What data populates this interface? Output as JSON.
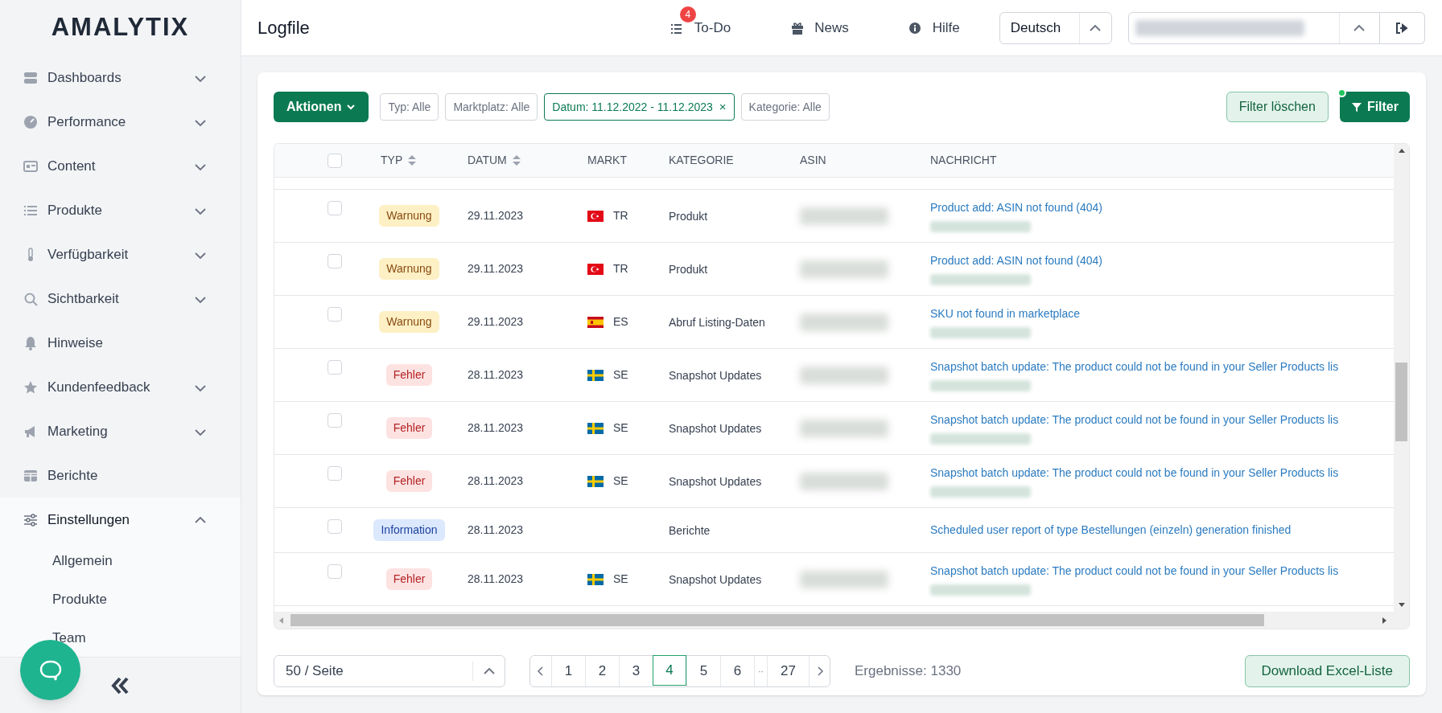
{
  "sidebar": {
    "logo": "AMALYTIX",
    "items": [
      {
        "label": "Dashboards",
        "expanded": false
      },
      {
        "label": "Performance",
        "expanded": false
      },
      {
        "label": "Content",
        "expanded": false
      },
      {
        "label": "Produkte",
        "expanded": false
      },
      {
        "label": "Verfügbarkeit",
        "expanded": false
      },
      {
        "label": "Sichtbarkeit",
        "expanded": false
      },
      {
        "label": "Hinweise"
      },
      {
        "label": "Kundenfeedback",
        "expanded": false
      },
      {
        "label": "Marketing",
        "expanded": false
      },
      {
        "label": "Berichte"
      },
      {
        "label": "Einstellungen",
        "expanded": true,
        "children": [
          {
            "label": "Allgemein"
          },
          {
            "label": "Produkte"
          },
          {
            "label": "Team"
          }
        ]
      }
    ]
  },
  "header": {
    "title": "Logfile",
    "nav": [
      {
        "label": "To-Do",
        "badge": "4"
      },
      {
        "label": "News"
      },
      {
        "label": "Hilfe"
      }
    ],
    "language": "Deutsch"
  },
  "filters": {
    "actions_button": "Aktionen",
    "chips": [
      {
        "label": "Typ: Alle",
        "active": false
      },
      {
        "label": "Marktplatz: Alle",
        "active": false
      },
      {
        "label": "Datum: 11.12.2022 - 11.12.2023",
        "active": true,
        "remove": "×"
      },
      {
        "label": "Kategorie: Alle",
        "active": false
      }
    ],
    "clear_button": "Filter löschen",
    "filter_button": {
      "label": "Filter",
      "active": true
    }
  },
  "table": {
    "header_checked": false,
    "columns": [
      {
        "label": "TYP",
        "sortable": true
      },
      {
        "label": "DATUM",
        "sortable": true
      },
      {
        "label": "MARKT",
        "sortable": false
      },
      {
        "label": "KATEGORIE",
        "sortable": false
      },
      {
        "label": "ASIN",
        "sortable": false
      },
      {
        "label": "NACHRICHT",
        "sortable": false
      }
    ],
    "rows": [
      {
        "checked": false,
        "type": {
          "label": "Warnung",
          "kind": "warning"
        },
        "date": "29.11.2023",
        "market": {
          "kind": "tr",
          "code": "TR"
        },
        "category": "Produkt",
        "asin_redacted": true,
        "message": "Product add: ASIN not found (404)",
        "detail_redacted": true
      },
      {
        "checked": false,
        "type": {
          "label": "Warnung",
          "kind": "warning"
        },
        "date": "29.11.2023",
        "market": {
          "kind": "tr",
          "code": "TR"
        },
        "category": "Produkt",
        "asin_redacted": true,
        "message": "Product add: ASIN not found (404)",
        "detail_redacted": true
      },
      {
        "checked": false,
        "type": {
          "label": "Warnung",
          "kind": "warning"
        },
        "date": "29.11.2023",
        "market": {
          "kind": "es",
          "code": "ES"
        },
        "category": "Abruf Listing-Daten",
        "asin_redacted": true,
        "message": "SKU not found in marketplace",
        "detail_redacted": true
      },
      {
        "checked": false,
        "type": {
          "label": "Fehler",
          "kind": "error"
        },
        "date": "28.11.2023",
        "market": {
          "kind": "se",
          "code": "SE"
        },
        "category": "Snapshot Updates",
        "asin_redacted": true,
        "message": "Snapshot batch update: The product could not be found in your Seller Products lis",
        "detail_redacted": true
      },
      {
        "checked": false,
        "type": {
          "label": "Fehler",
          "kind": "error"
        },
        "date": "28.11.2023",
        "market": {
          "kind": "se",
          "code": "SE"
        },
        "category": "Snapshot Updates",
        "asin_redacted": true,
        "message": "Snapshot batch update: The product could not be found in your Seller Products lis",
        "detail_redacted": true
      },
      {
        "checked": false,
        "type": {
          "label": "Fehler",
          "kind": "error"
        },
        "date": "28.11.2023",
        "market": {
          "kind": "se",
          "code": "SE"
        },
        "category": "Snapshot Updates",
        "asin_redacted": true,
        "message": "Snapshot batch update: The product could not be found in your Seller Products lis",
        "detail_redacted": true
      },
      {
        "checked": false,
        "type": {
          "label": "Information",
          "kind": "info"
        },
        "date": "28.11.2023",
        "category": "Berichte",
        "asin_redacted": false,
        "message": "Scheduled user report of type Bestellungen (einzeln) generation finished",
        "detail_redacted": false
      },
      {
        "checked": false,
        "type": {
          "label": "Fehler",
          "kind": "error"
        },
        "date": "28.11.2023",
        "market": {
          "kind": "se",
          "code": "SE"
        },
        "category": "Snapshot Updates",
        "asin_redacted": true,
        "message": "Snapshot batch update: The product could not be found in your Seller Products lis",
        "detail_redacted": true
      }
    ]
  },
  "pagination": {
    "page_size": "50 / Seite",
    "pages": [
      {
        "label": "1",
        "selected": false
      },
      {
        "label": "2",
        "selected": false
      },
      {
        "label": "3",
        "selected": false
      },
      {
        "label": "4",
        "selected": true
      },
      {
        "label": "5",
        "selected": false
      },
      {
        "label": "6",
        "selected": false
      },
      {
        "label": "··",
        "kind": "gap"
      },
      {
        "label": "27",
        "selected": false
      }
    ],
    "results": "Ergebnisse: 1330",
    "download_button": "Download Excel-Liste"
  }
}
